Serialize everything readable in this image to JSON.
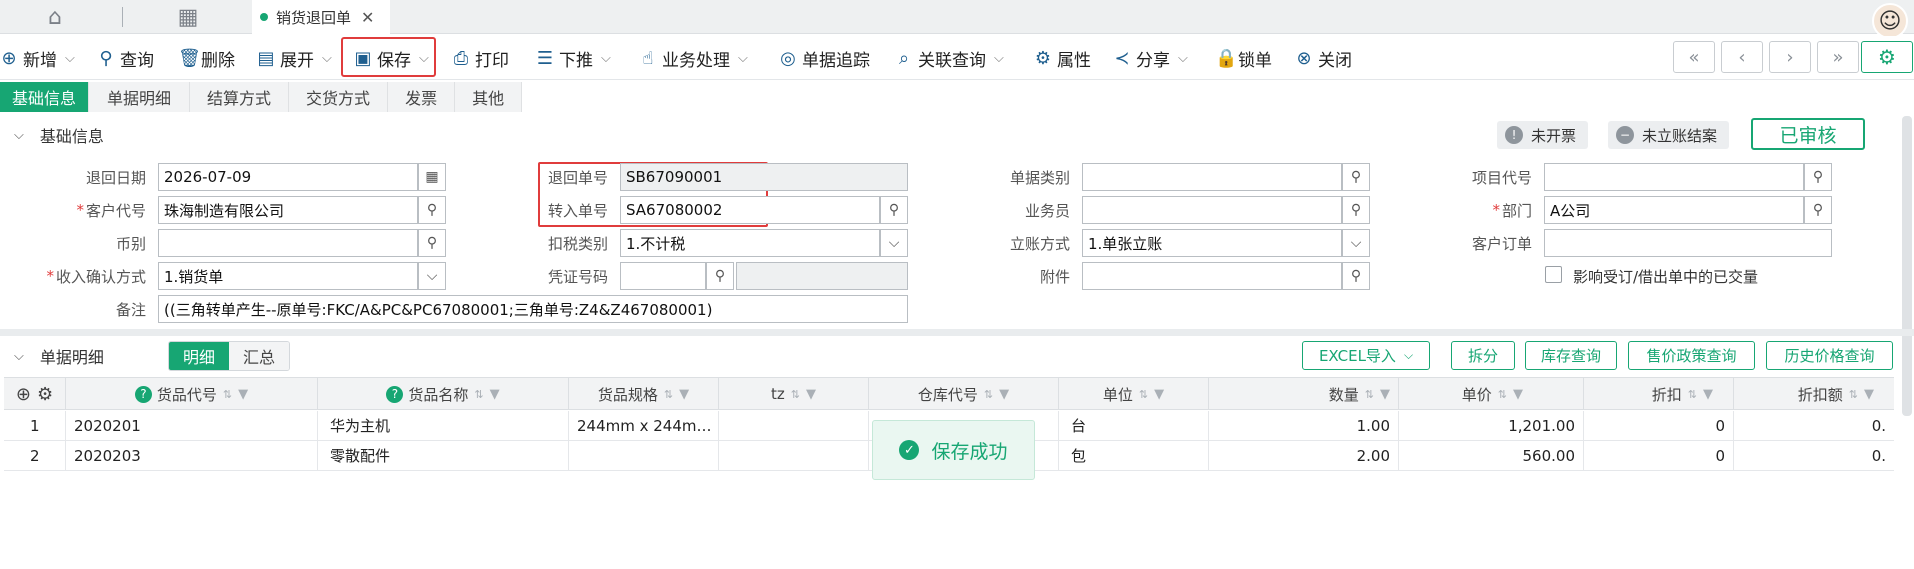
{
  "tabs": {
    "active_label": "销货退回单",
    "home_icon": "home-icon",
    "grid_icon": "grid-icon"
  },
  "toolbar": {
    "new": "新增",
    "query": "查询",
    "delete": "删除",
    "expand": "展开",
    "save": "保存",
    "print": "打印",
    "push": "下推",
    "business": "业务处理",
    "trace": "单据追踪",
    "related": "关联查询",
    "properties": "属性",
    "share": "分享",
    "lock": "锁单",
    "close": "关闭"
  },
  "subtabs": [
    "基础信息",
    "单据明细",
    "结算方式",
    "交货方式",
    "发票",
    "其他"
  ],
  "basic_section": {
    "title": "基础信息",
    "badge_invoice": "未开票",
    "badge_account": "未立账结案",
    "status": "已审核"
  },
  "form": {
    "return_date": {
      "label": "退回日期",
      "value": "2026-07-09"
    },
    "customer_code": {
      "label": "客户代号",
      "value": "珠海制造有限公司"
    },
    "currency": {
      "label": "币别",
      "value": ""
    },
    "income_confirm": {
      "label": "收入确认方式",
      "value": "1.销货单"
    },
    "remark": {
      "label": "备注",
      "value": "((三角转单产生--原单号:FKC/A&PC&PC67080001;三角单号:Z4&Z467080001)"
    },
    "return_no": {
      "label": "退回单号",
      "value": "SB67090001"
    },
    "transfer_no": {
      "label": "转入单号",
      "value": "SA67080002"
    },
    "tax_type": {
      "label": "扣税类别",
      "value": "1.不计税"
    },
    "voucher_no": {
      "label": "凭证号码",
      "value": ""
    },
    "doc_type": {
      "label": "单据类别",
      "value": ""
    },
    "salesperson": {
      "label": "业务员",
      "value": ""
    },
    "account_method": {
      "label": "立账方式",
      "value": "1.单张立账"
    },
    "attachment": {
      "label": "附件",
      "value": ""
    },
    "project_code": {
      "label": "项目代号",
      "value": ""
    },
    "department": {
      "label": "部门",
      "value": "A公司"
    },
    "customer_order": {
      "label": "客户订单",
      "value": ""
    },
    "affect_label": "影响受订/借出单中的已交量"
  },
  "detail_section": {
    "title": "单据明细",
    "toggle_detail": "明细",
    "toggle_summary": "汇总",
    "buttons": {
      "excel": "EXCEL导入",
      "split": "拆分",
      "stock": "库存查询",
      "policy": "售价政策查询",
      "history": "历史价格查询"
    }
  },
  "grid": {
    "columns": [
      "货品代号",
      "货品名称",
      "货品规格",
      "tz",
      "仓库代号",
      "单位",
      "数量",
      "单价",
      "折扣",
      "折扣额"
    ],
    "rows": [
      {
        "no": "1",
        "code": "2020201",
        "name": "华为主机",
        "spec": "244mm x 244m…",
        "tz": "",
        "warehouse": "",
        "unit": "台",
        "qty": "1.00",
        "price": "1,201.00",
        "discount": "0",
        "discount_amt": "0."
      },
      {
        "no": "2",
        "code": "2020203",
        "name": "零散配件",
        "spec": "",
        "tz": "",
        "warehouse": "",
        "unit": "包",
        "qty": "2.00",
        "price": "560.00",
        "discount": "0",
        "discount_amt": "0."
      }
    ]
  },
  "toast": "保存成功",
  "colors": {
    "accent": "#17a673",
    "highlight": "#e03c3c"
  }
}
